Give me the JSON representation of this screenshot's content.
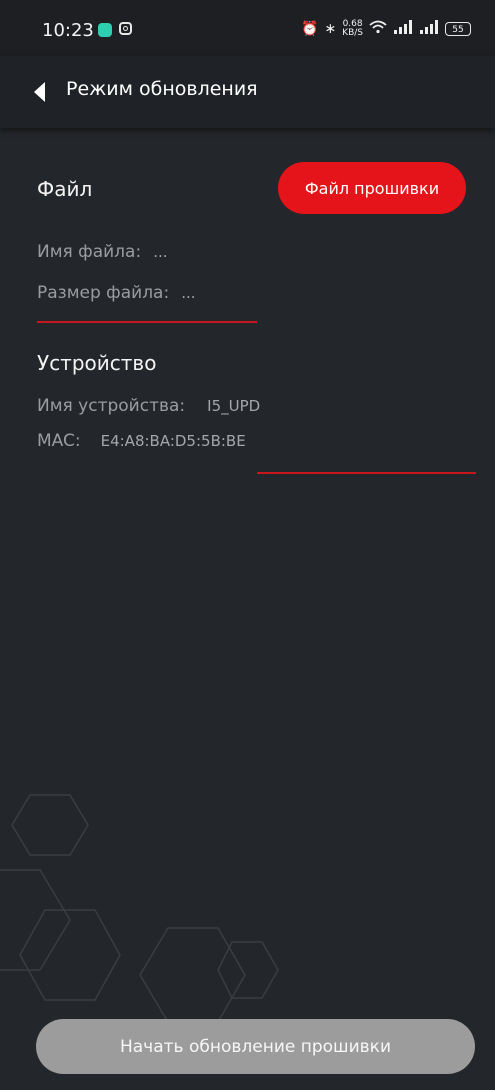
{
  "status_bar": {
    "time": "10:23",
    "net_speed_value": "0.68",
    "net_speed_unit": "KB/S",
    "battery": "55"
  },
  "app_bar": {
    "title": "Режим обновления"
  },
  "file_section": {
    "title": "Файл",
    "firmware_button_label": "Файл прошивки",
    "file_name_label": "Имя файла:",
    "file_name_value": "...",
    "file_size_label": "Размер файла:",
    "file_size_value": "..."
  },
  "device_section": {
    "title": "Устройство",
    "device_name_label": "Имя устройства:",
    "device_name_value": "I5_UPD",
    "mac_label": "MAC:",
    "mac_value": "E4:A8:BA:D5:5B:BE"
  },
  "footer": {
    "start_button_label": "Начать обновление прошивки"
  },
  "colors": {
    "background": "#23262a",
    "accent_red": "#e5141a",
    "disabled_button": "#9c9c9c"
  }
}
